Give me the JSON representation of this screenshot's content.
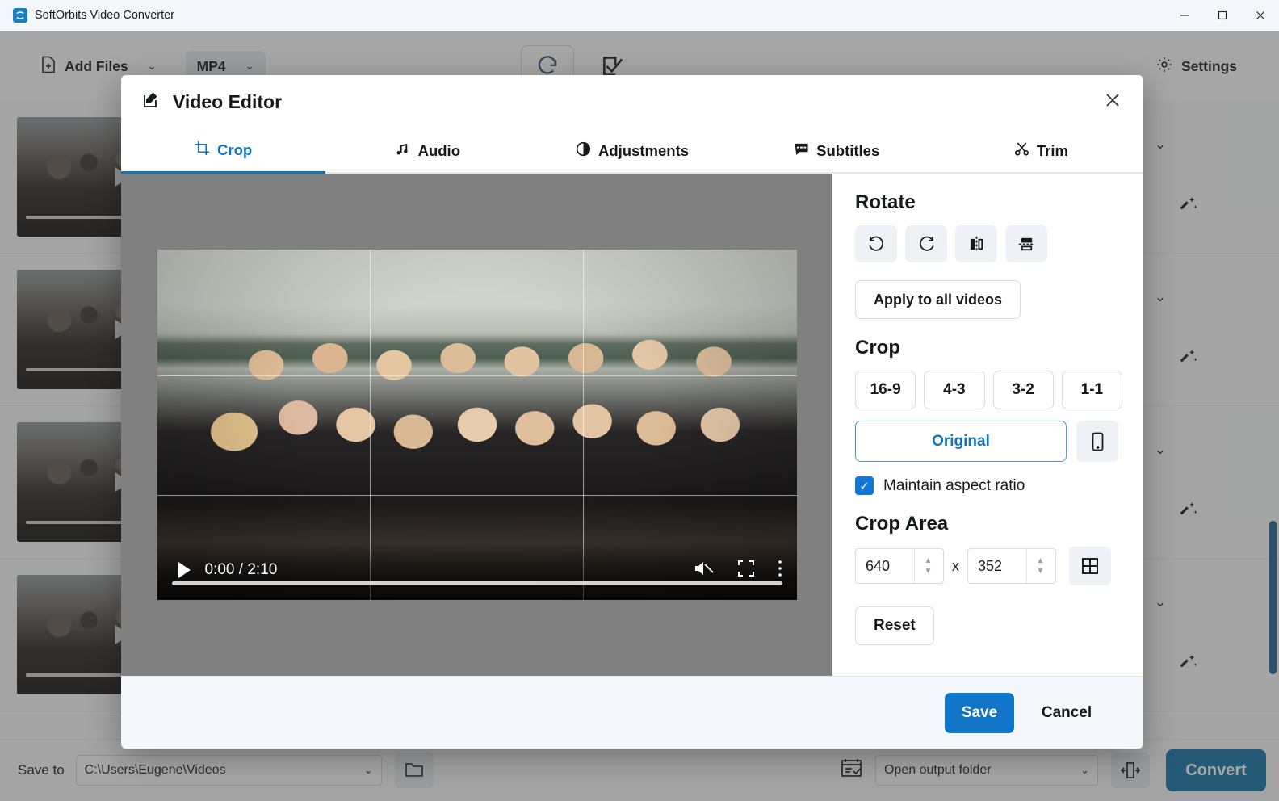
{
  "window": {
    "title": "SoftOrbits Video Converter",
    "app_icon": "app-logo-icon",
    "minimize": "—",
    "maximize": "□",
    "close": "✕"
  },
  "toolbar": {
    "add_files_label": "Add Files",
    "add_files_chevron": "⌄",
    "format_label": "MP4",
    "format_chevron": "⌄",
    "refresh_icon": "refresh-icon",
    "select_all_icon": "checkbox-check-icon",
    "settings_label": "Settings",
    "settings_icon": "gear-icon"
  },
  "file_list": {
    "rows": [
      {
        "chevron": "⌄",
        "wand": "✦"
      },
      {
        "chevron": "⌄",
        "wand": "✦"
      },
      {
        "chevron": "⌄",
        "wand": "✦"
      },
      {
        "chevron": "⌄",
        "wand": "✦"
      }
    ]
  },
  "bottom_bar": {
    "save_to_label": "Save to",
    "save_to_value": "C:\\Users\\Eugene\\Videos",
    "save_to_chevron": "⌄",
    "folder_icon": "folder-icon",
    "calendar_icon": "task-list-icon",
    "after_convert_value": "Open output folder",
    "after_convert_chevron": "⌄",
    "merge_icon": "merge-icon",
    "convert_label": "Convert"
  },
  "modal": {
    "title": "Video Editor",
    "title_icon": "edit-pencil-icon",
    "close_icon": "close-icon",
    "tabs": [
      {
        "label": "Crop",
        "icon": "crop-icon",
        "active": true
      },
      {
        "label": "Audio",
        "icon": "music-note-icon",
        "active": false
      },
      {
        "label": "Adjustments",
        "icon": "contrast-icon",
        "active": false
      },
      {
        "label": "Subtitles",
        "icon": "subtitles-icon",
        "active": false
      },
      {
        "label": "Trim",
        "icon": "scissors-icon",
        "active": false
      }
    ],
    "player": {
      "play_icon": "play-icon",
      "time": "0:00 / 2:10",
      "mute_icon": "volume-muted-icon",
      "fullscreen_icon": "fullscreen-icon",
      "more_icon": "kebab-menu-icon"
    },
    "panel": {
      "rotate_title": "Rotate",
      "rotate_buttons": [
        {
          "icon": "rotate-left-icon"
        },
        {
          "icon": "rotate-right-icon"
        },
        {
          "icon": "flip-horizontal-icon"
        },
        {
          "icon": "flip-vertical-icon"
        }
      ],
      "apply_all_label": "Apply to all videos",
      "crop_title": "Crop",
      "ratios": [
        "16-9",
        "4-3",
        "3-2",
        "1-1"
      ],
      "original_label": "Original",
      "original_selected": true,
      "portrait_icon": "phone-portrait-icon",
      "maintain_aspect_label": "Maintain aspect ratio",
      "maintain_aspect_checked": true,
      "check_glyph": "✓",
      "crop_area_title": "Crop Area",
      "crop_width": "640",
      "crop_height": "352",
      "crop_x_separator": "x",
      "grid_icon": "grid-toggle-icon",
      "reset_label": "Reset"
    },
    "footer": {
      "save_label": "Save",
      "cancel_label": "Cancel"
    }
  },
  "colors": {
    "accent_blue": "#1176c8",
    "link_blue": "#1176b8",
    "convert_blue": "#1273a8",
    "checkbox_blue": "#1176d6",
    "stage_gray": "#808080",
    "scrollbar": "#1b6591"
  }
}
